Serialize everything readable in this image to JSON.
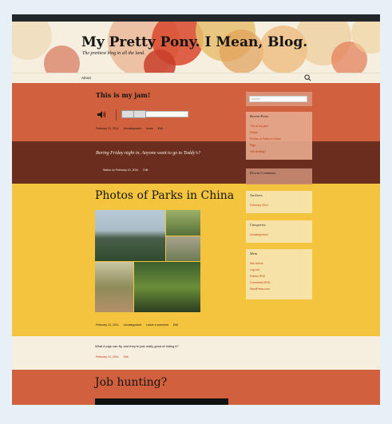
{
  "site": {
    "title": "My Pretty Pony. I Mean, Blog.",
    "description": "The prettiest blog in all the land."
  },
  "nav": {
    "about": "About"
  },
  "audio_post": {
    "title": "This is my jam!",
    "meta": {
      "date": "February 10, 2014",
      "category": "Uncategorized",
      "tag": "tunes",
      "edit": "Edit"
    }
  },
  "status_post": {
    "text": "Boring Friday night in. Anyone want to go to Toddy's?",
    "meta": {
      "date": "Status on February 10, 2014",
      "edit": "Edit"
    }
  },
  "gallery_post": {
    "title": "Photos of Parks in China",
    "meta": {
      "date": "February 10, 2014",
      "category": "Uncategorized",
      "comment": "Leave a comment",
      "edit": "Edit"
    }
  },
  "aside_post": {
    "text": "What if pigs can fly, and they're just really good at hiding it?",
    "meta": {
      "date": "February 10, 2014",
      "edit": "Edit"
    }
  },
  "video_post": {
    "title": "Job hunting?"
  },
  "sidebar": {
    "search_placeholder": "Search ...",
    "recent_posts": {
      "title": "Recent Posts",
      "items": [
        "This is my jam!",
        "Friday",
        "Photos of Parks in China",
        "Pigs",
        "Job hunting?"
      ]
    },
    "recent_comments": {
      "title": "Recent Comments"
    },
    "archives": {
      "title": "Archives",
      "items": [
        "February 2014"
      ]
    },
    "categories": {
      "title": "Categories",
      "items": [
        "Uncategorized"
      ]
    },
    "meta": {
      "title": "Meta",
      "items": [
        "Site Admin",
        "Log out",
        "Entries RSS",
        "Comments RSS",
        "WordPress.com"
      ]
    }
  },
  "colors": {
    "header_bg": "#f6efe0",
    "audio_bg": "#d0603e",
    "status_bg": "#6b2d1e",
    "gallery_bg": "#f5c43f",
    "link": "#bc360a"
  }
}
